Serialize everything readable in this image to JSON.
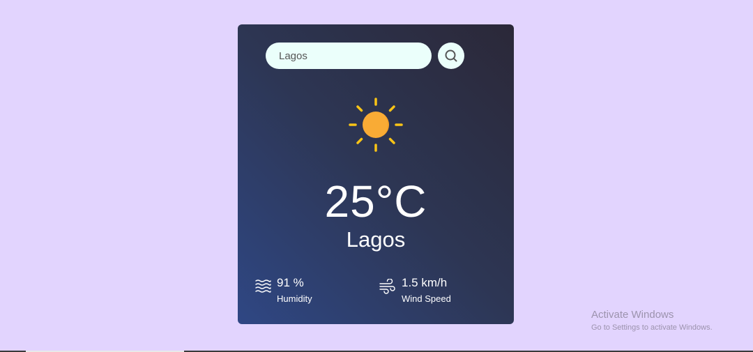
{
  "search": {
    "value": "Lagos",
    "icon": "search-icon"
  },
  "weather": {
    "icon": "sun-icon",
    "temperature": "25°C",
    "city": "Lagos"
  },
  "details": {
    "humidity": {
      "icon": "waves-icon",
      "value": "91 %",
      "label": "Humidity"
    },
    "wind": {
      "icon": "wind-icon",
      "value": "1.5 km/h",
      "label": "Wind Speed"
    }
  },
  "watermark": {
    "title": "Activate Windows",
    "subtitle": "Go to Settings to activate Windows."
  },
  "colors": {
    "background": "#e2d4fe",
    "card_gradient_dark": "#2b2838",
    "card_gradient_blue": "#2f4784",
    "input_bg": "#ebfffb",
    "sun_core": "#f9ab35",
    "sun_rays": "#f9c416"
  }
}
